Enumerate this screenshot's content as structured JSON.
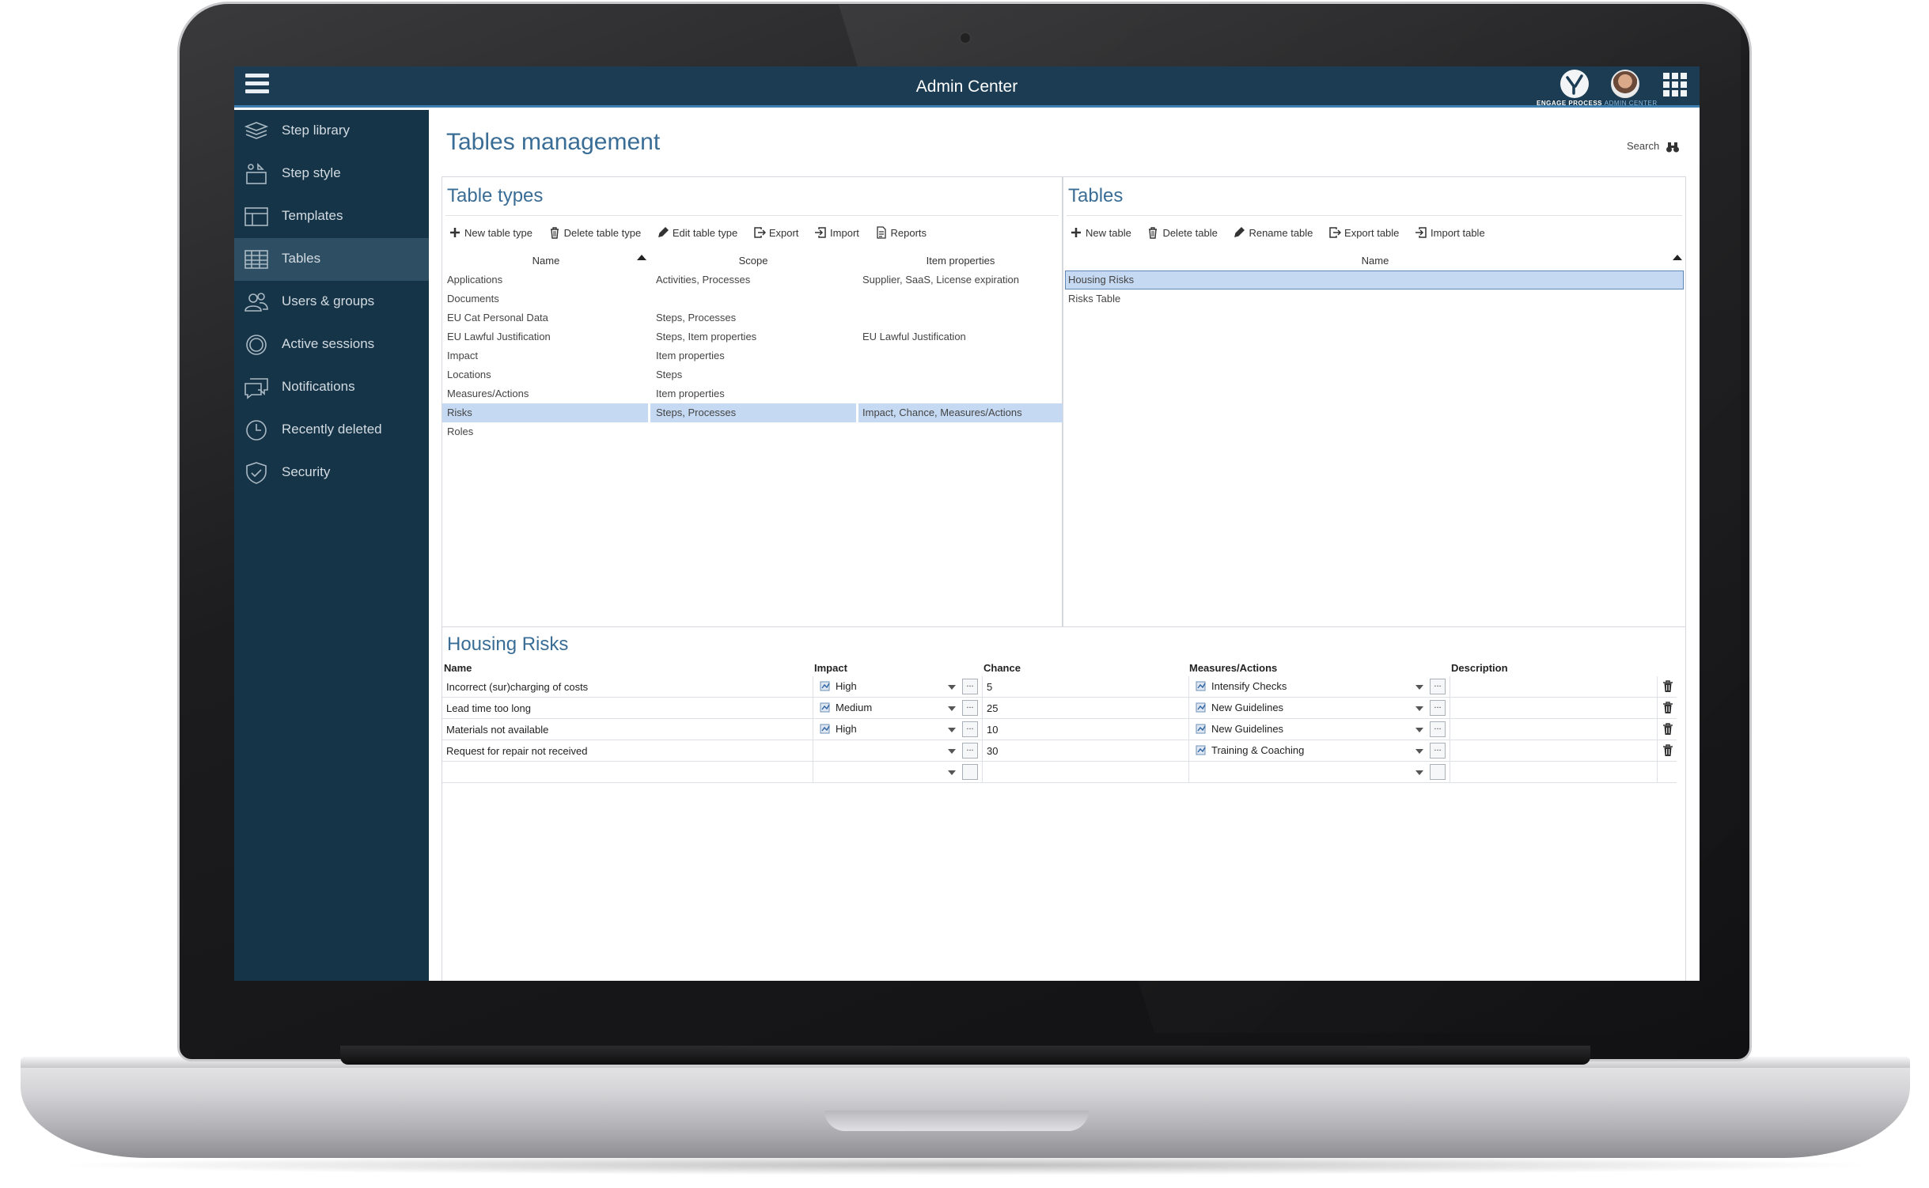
{
  "app": {
    "title": "Admin Center",
    "brand": "ENGAGE PROCESS",
    "brand_sub": "ADMIN CENTER",
    "accent": "#3a6d96",
    "topbar_color": "#1b3c52",
    "sidebar_color": "#163447",
    "selection_color": "#c5d9f2"
  },
  "sidebar": {
    "items": [
      {
        "label": "Step library",
        "icon": "layers-icon"
      },
      {
        "label": "Step style",
        "icon": "shapes-icon"
      },
      {
        "label": "Templates",
        "icon": "template-icon"
      },
      {
        "label": "Tables",
        "icon": "table-icon",
        "active": true
      },
      {
        "label": "Users & groups",
        "icon": "users-icon"
      },
      {
        "label": "Active sessions",
        "icon": "sessions-icon"
      },
      {
        "label": "Notifications",
        "icon": "chat-icon"
      },
      {
        "label": "Recently deleted",
        "icon": "clock-icon"
      },
      {
        "label": "Security",
        "icon": "shield-icon"
      }
    ]
  },
  "main": {
    "title": "Tables management",
    "search_label": "Search"
  },
  "table_types": {
    "title": "Table types",
    "toolbar": [
      "New table type",
      "Delete table type",
      "Edit table type",
      "Export",
      "Import",
      "Reports"
    ],
    "columns": [
      "Name",
      "Scope",
      "Item properties"
    ],
    "rows": [
      [
        "Applications",
        "Activities, Processes",
        "Supplier, SaaS, License expiration"
      ],
      [
        "Documents",
        "",
        ""
      ],
      [
        "EU Cat Personal Data",
        "Steps, Processes",
        ""
      ],
      [
        "EU Lawful Justification",
        "Steps, Item properties",
        "EU Lawful Justification"
      ],
      [
        "Impact",
        "Item properties",
        ""
      ],
      [
        "Locations",
        "Steps",
        ""
      ],
      [
        "Measures/Actions",
        "Item properties",
        ""
      ],
      [
        "Risks",
        "Steps, Processes",
        "Impact, Chance, Measures/Actions"
      ],
      [
        "Roles",
        "",
        ""
      ]
    ],
    "selected_row": 7
  },
  "tables": {
    "title": "Tables",
    "toolbar": [
      "New table",
      "Delete table",
      "Rename table",
      "Export table",
      "Import table"
    ],
    "column": "Name",
    "rows": [
      "Housing Risks",
      "Risks Table"
    ],
    "selected_row": 0
  },
  "housing_risks": {
    "title": "Housing Risks",
    "columns": [
      "Name",
      "Impact",
      "Chance",
      "Measures/Actions",
      "Description"
    ],
    "ellipsis": "...",
    "rows": [
      {
        "name": "Incorrect (sur)charging of costs",
        "impact": "High",
        "chance": "5",
        "measure": "Intensify Checks",
        "description": ""
      },
      {
        "name": "Lead time too long",
        "impact": "Medium",
        "chance": "25",
        "measure": "New Guidelines",
        "description": ""
      },
      {
        "name": "Materials not available",
        "impact": "High",
        "chance": "10",
        "measure": "New Guidelines",
        "description": ""
      },
      {
        "name": "Request for repair not received",
        "impact": "",
        "chance": "30",
        "measure": "Training & Coaching",
        "description": ""
      }
    ]
  }
}
